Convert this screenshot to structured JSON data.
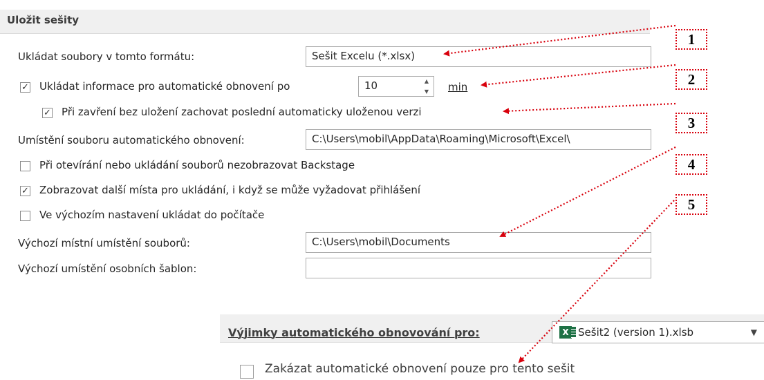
{
  "section": {
    "title": "Uložit sešity"
  },
  "rows": {
    "format_label": "Ukládat soubory v tomto formátu:",
    "format_value": "Sešit Excelu (*.xlsx)",
    "autorecover_label": "Ukládat informace pro automatické obnovení po",
    "autorecover_minutes": "10",
    "autorecover_unit": "min",
    "keep_last_label": "Při zavření bez uložení zachovat poslední automaticky uloženou verzi",
    "autorecover_location_label": "Umístění souboru automatického obnovení:",
    "autorecover_location_value": "C:\\Users\\mobil\\AppData\\Roaming\\Microsoft\\Excel\\",
    "no_backstage_label": "Při otevírání nebo ukládání souborů nezobrazovat Backstage",
    "show_places_label": "Zobrazovat další místa pro ukládání, i když se může vyžadovat přihlášení",
    "save_to_computer_label": "Ve výchozím nastavení ukládat do počítače",
    "default_local_label": "Výchozí místní umístění souborů:",
    "default_local_value": "C:\\Users\\mobil\\Documents",
    "templates_label": "Výchozí umístění osobních šablon:",
    "templates_value": ""
  },
  "checks": {
    "autorecover": true,
    "keep_last": true,
    "no_backstage": false,
    "show_places": true,
    "save_to_computer": false,
    "disable_autorecover": false
  },
  "check_glyph": "✓",
  "lower": {
    "exceptions_label": "Výjimky automatického obnovování pro:",
    "workbook_value": "Sešit2 (version 1).xlsb",
    "disable_label": "Zakázat automatické obnovení pouze pro tento sešit",
    "excel_icon_letter": "X",
    "dropdown_glyph": "▼"
  },
  "callouts": [
    "1",
    "2",
    "3",
    "4",
    "5"
  ],
  "colors": {
    "callout_red": "#d8000c",
    "excel_green": "#1e7145"
  },
  "icons": [
    "checkbox-checked-icon",
    "checkbox-unchecked-icon",
    "spin-up-icon",
    "spin-down-icon",
    "excel-file-icon",
    "dropdown-arrow-icon"
  ]
}
